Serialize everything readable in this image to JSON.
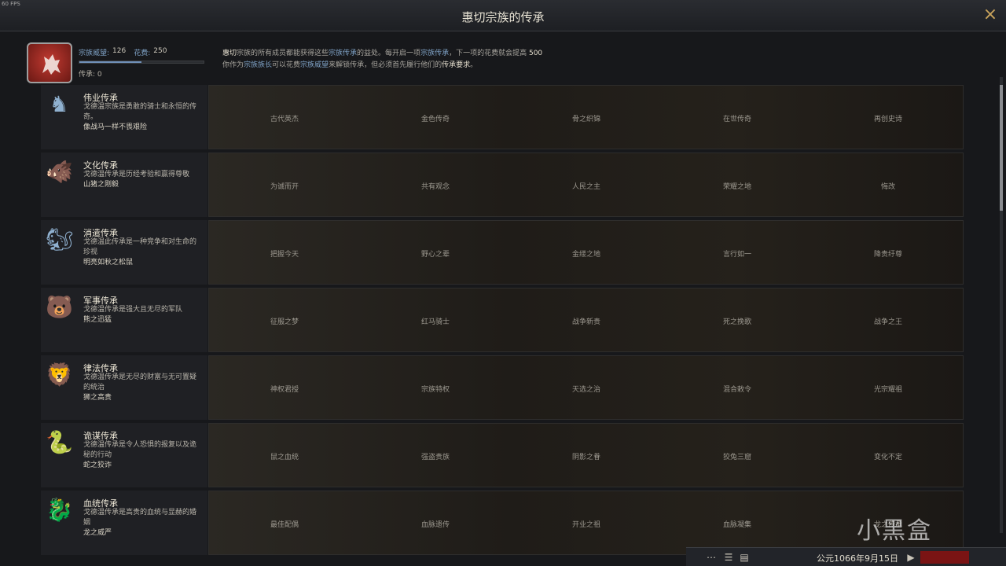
{
  "fps_label": "60 FPS",
  "window": {
    "title": "惠切宗族的传承",
    "close_icon": "×"
  },
  "stats": {
    "renown_label": "宗族威望:",
    "renown_value": "126",
    "cost_label": "花费:",
    "cost_value": "250",
    "legacies_label": "传承:",
    "legacies_value": "0",
    "renown_progress": 0.5
  },
  "description": {
    "line1_a": "惠切",
    "line1_b": "宗族的所有成员都能获得这些",
    "line1_c": "宗族传承",
    "line1_d": "的益处。每开启一项",
    "line1_e": "宗族传承",
    "line1_f": "，下一项的花费就会提高",
    "line1_g": "500",
    "line2_a": "你作为",
    "line2_b": "宗族族长",
    "line2_c": "可以花费",
    "line2_d": "宗族威望",
    "line2_e": "来解锁传承，但必须首先履行他们的",
    "line2_f": "传承要求",
    "line2_g": "。"
  },
  "legacies": [
    {
      "name": "伟业传承",
      "desc": "戈德温宗族是勇敢的骑士和永恒的传奇。",
      "subtitle": "像战马一样不畏艰险",
      "icon": "horse-icon",
      "perks": [
        "古代英杰",
        "金色传奇",
        "骨之织锦",
        "在世传奇",
        "再创史诗"
      ]
    },
    {
      "name": "文化传承",
      "desc": "戈德温传承是历经考验和赢得尊敬",
      "subtitle": "山猪之刚毅",
      "icon": "boar-icon",
      "perks": [
        "为诚而开",
        "共有观念",
        "人民之主",
        "荣耀之地",
        "悔改"
      ]
    },
    {
      "name": "消遣传承",
      "desc": "戈德温此传承是一种竞争和对生命的珍视",
      "subtitle": "明亮如秋之松鼠",
      "icon": "squirrel-icon",
      "perks": [
        "把握今天",
        "野心之辈",
        "金缕之地",
        "言行如一",
        "降贵纡尊"
      ]
    },
    {
      "name": "军事传承",
      "desc": "戈德温传承是强大且无尽的军队",
      "subtitle": "熊之迅猛",
      "icon": "bear-icon",
      "perks": [
        "征服之梦",
        "红马骑士",
        "战争新贵",
        "死之挽歌",
        "战争之王"
      ]
    },
    {
      "name": "律法传承",
      "desc": "戈德温传承是无尽的财富与无可置疑的统治",
      "subtitle": "狮之高贵",
      "icon": "lion-icon",
      "perks": [
        "神权君授",
        "宗族特权",
        "天选之治",
        "混合敕令",
        "光宗耀祖"
      ]
    },
    {
      "name": "诡谋传承",
      "desc": "戈德温传承是令人恐惧的报复以及诡秘的行动",
      "subtitle": "蛇之狡诈",
      "icon": "snake-icon",
      "perks": [
        "鼠之血统",
        "强盗贵族",
        "阴影之眷",
        "狡兔三窟",
        "变化不定"
      ]
    },
    {
      "name": "血统传承",
      "desc": "戈德温传承是高贵的血统与显赫的婚姻",
      "subtitle": "龙之威严",
      "icon": "dragon-icon",
      "perks": [
        "最佳配偶",
        "血脉遗传",
        "开业之祖",
        "血脉凝集",
        "龙之传承"
      ]
    }
  ],
  "footer": {
    "date": "公元1066年9月15日"
  },
  "watermark": "小黑盒"
}
